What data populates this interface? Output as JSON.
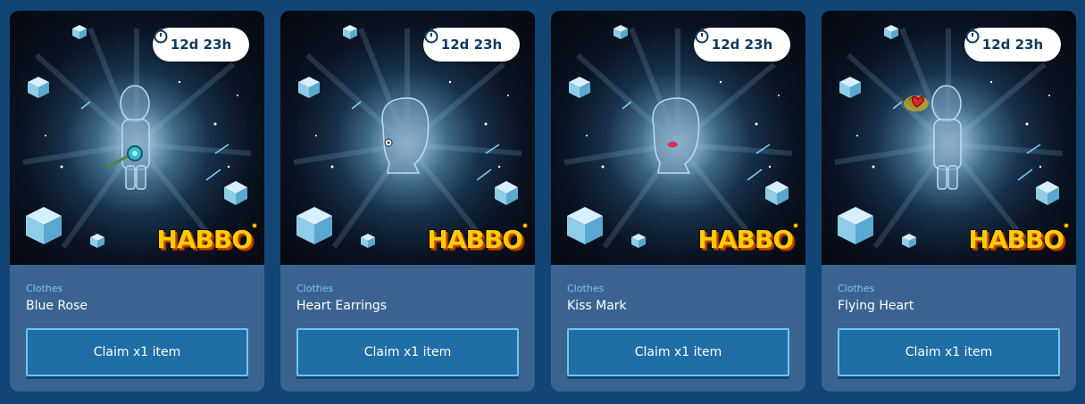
{
  "items": [
    {
      "category": "Clothes",
      "name": "Blue Rose",
      "timer": "12d 23h",
      "button": "Claim x1 item",
      "logo": "HABBO",
      "avatar": "full-body",
      "accent": "#3ab8c8"
    },
    {
      "category": "Clothes",
      "name": "Heart Earrings",
      "timer": "12d 23h",
      "button": "Claim x1 item",
      "logo": "HABBO",
      "avatar": "head",
      "accent": "#ffffff"
    },
    {
      "category": "Clothes",
      "name": "Kiss Mark",
      "timer": "12d 23h",
      "button": "Claim x1 item",
      "logo": "HABBO",
      "avatar": "head",
      "accent": "#d0305a"
    },
    {
      "category": "Clothes",
      "name": "Flying Heart",
      "timer": "12d 23h",
      "button": "Claim x1 item",
      "logo": "HABBO",
      "avatar": "full-body",
      "accent": "#e0242c"
    }
  ],
  "icons": {
    "timer": "stopwatch-icon"
  },
  "colors": {
    "page_bg": "#124573",
    "card_bg": "#3a648f",
    "button_bg": "#1f6ea6",
    "button_border": "#6ec6f0",
    "category_text": "#7fc4f2"
  }
}
